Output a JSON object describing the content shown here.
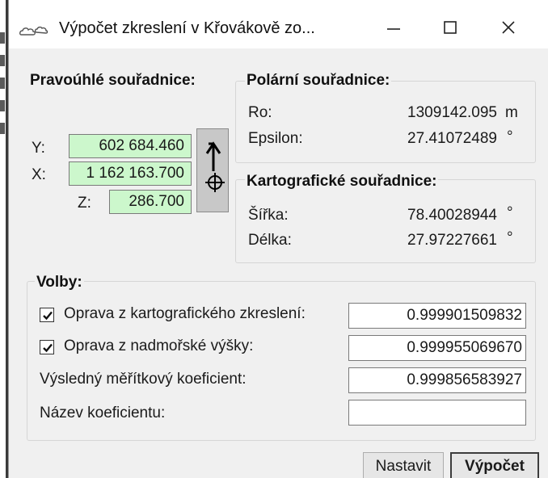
{
  "window": {
    "title": "Výpočet zkreslení v Křovákově zo...",
    "icon": "cloud-icon",
    "controls": {
      "minimize": "minimize-icon",
      "maximize": "maximize-icon",
      "close": "close-icon"
    }
  },
  "rectangular": {
    "title": "Pravoúhlé souřadnice:",
    "y_label": "Y:",
    "y_value": "602 684.460",
    "x_label": "X:",
    "x_value": "1 162 163.700",
    "z_label": "Z:",
    "z_value": "286.700",
    "input_color": "#ccf7cc",
    "swap_icon": "swap-arrow-target-icon"
  },
  "polar": {
    "title": "Polární souřadnice:",
    "ro_label": "Ro:",
    "ro_value": "1309142.095",
    "ro_unit": "m",
    "eps_label": "Epsilon:",
    "eps_value": "27.41072489",
    "eps_unit": "°"
  },
  "cartographic": {
    "title": "Kartografické souřadnice:",
    "lat_label": "Šířka:",
    "lat_value": "78.40028944",
    "lat_unit": "°",
    "lon_label": "Délka:",
    "lon_value": "27.97227661",
    "lon_unit": "°"
  },
  "options": {
    "title": "Volby:",
    "carto_label": "Oprava z kartografického zkreslení:",
    "carto_checked": true,
    "carto_value": "0.999901509832",
    "altitude_label": "Oprava z nadmořské výšky:",
    "altitude_checked": true,
    "altitude_value": "0.999955069670",
    "result_label": "Výsledný měřítkový koeficient:",
    "result_value": "0.999856583927",
    "name_label": "Název koeficientu:",
    "name_value": ""
  },
  "buttons": {
    "set": "Nastavit",
    "compute": "Výpočet"
  }
}
